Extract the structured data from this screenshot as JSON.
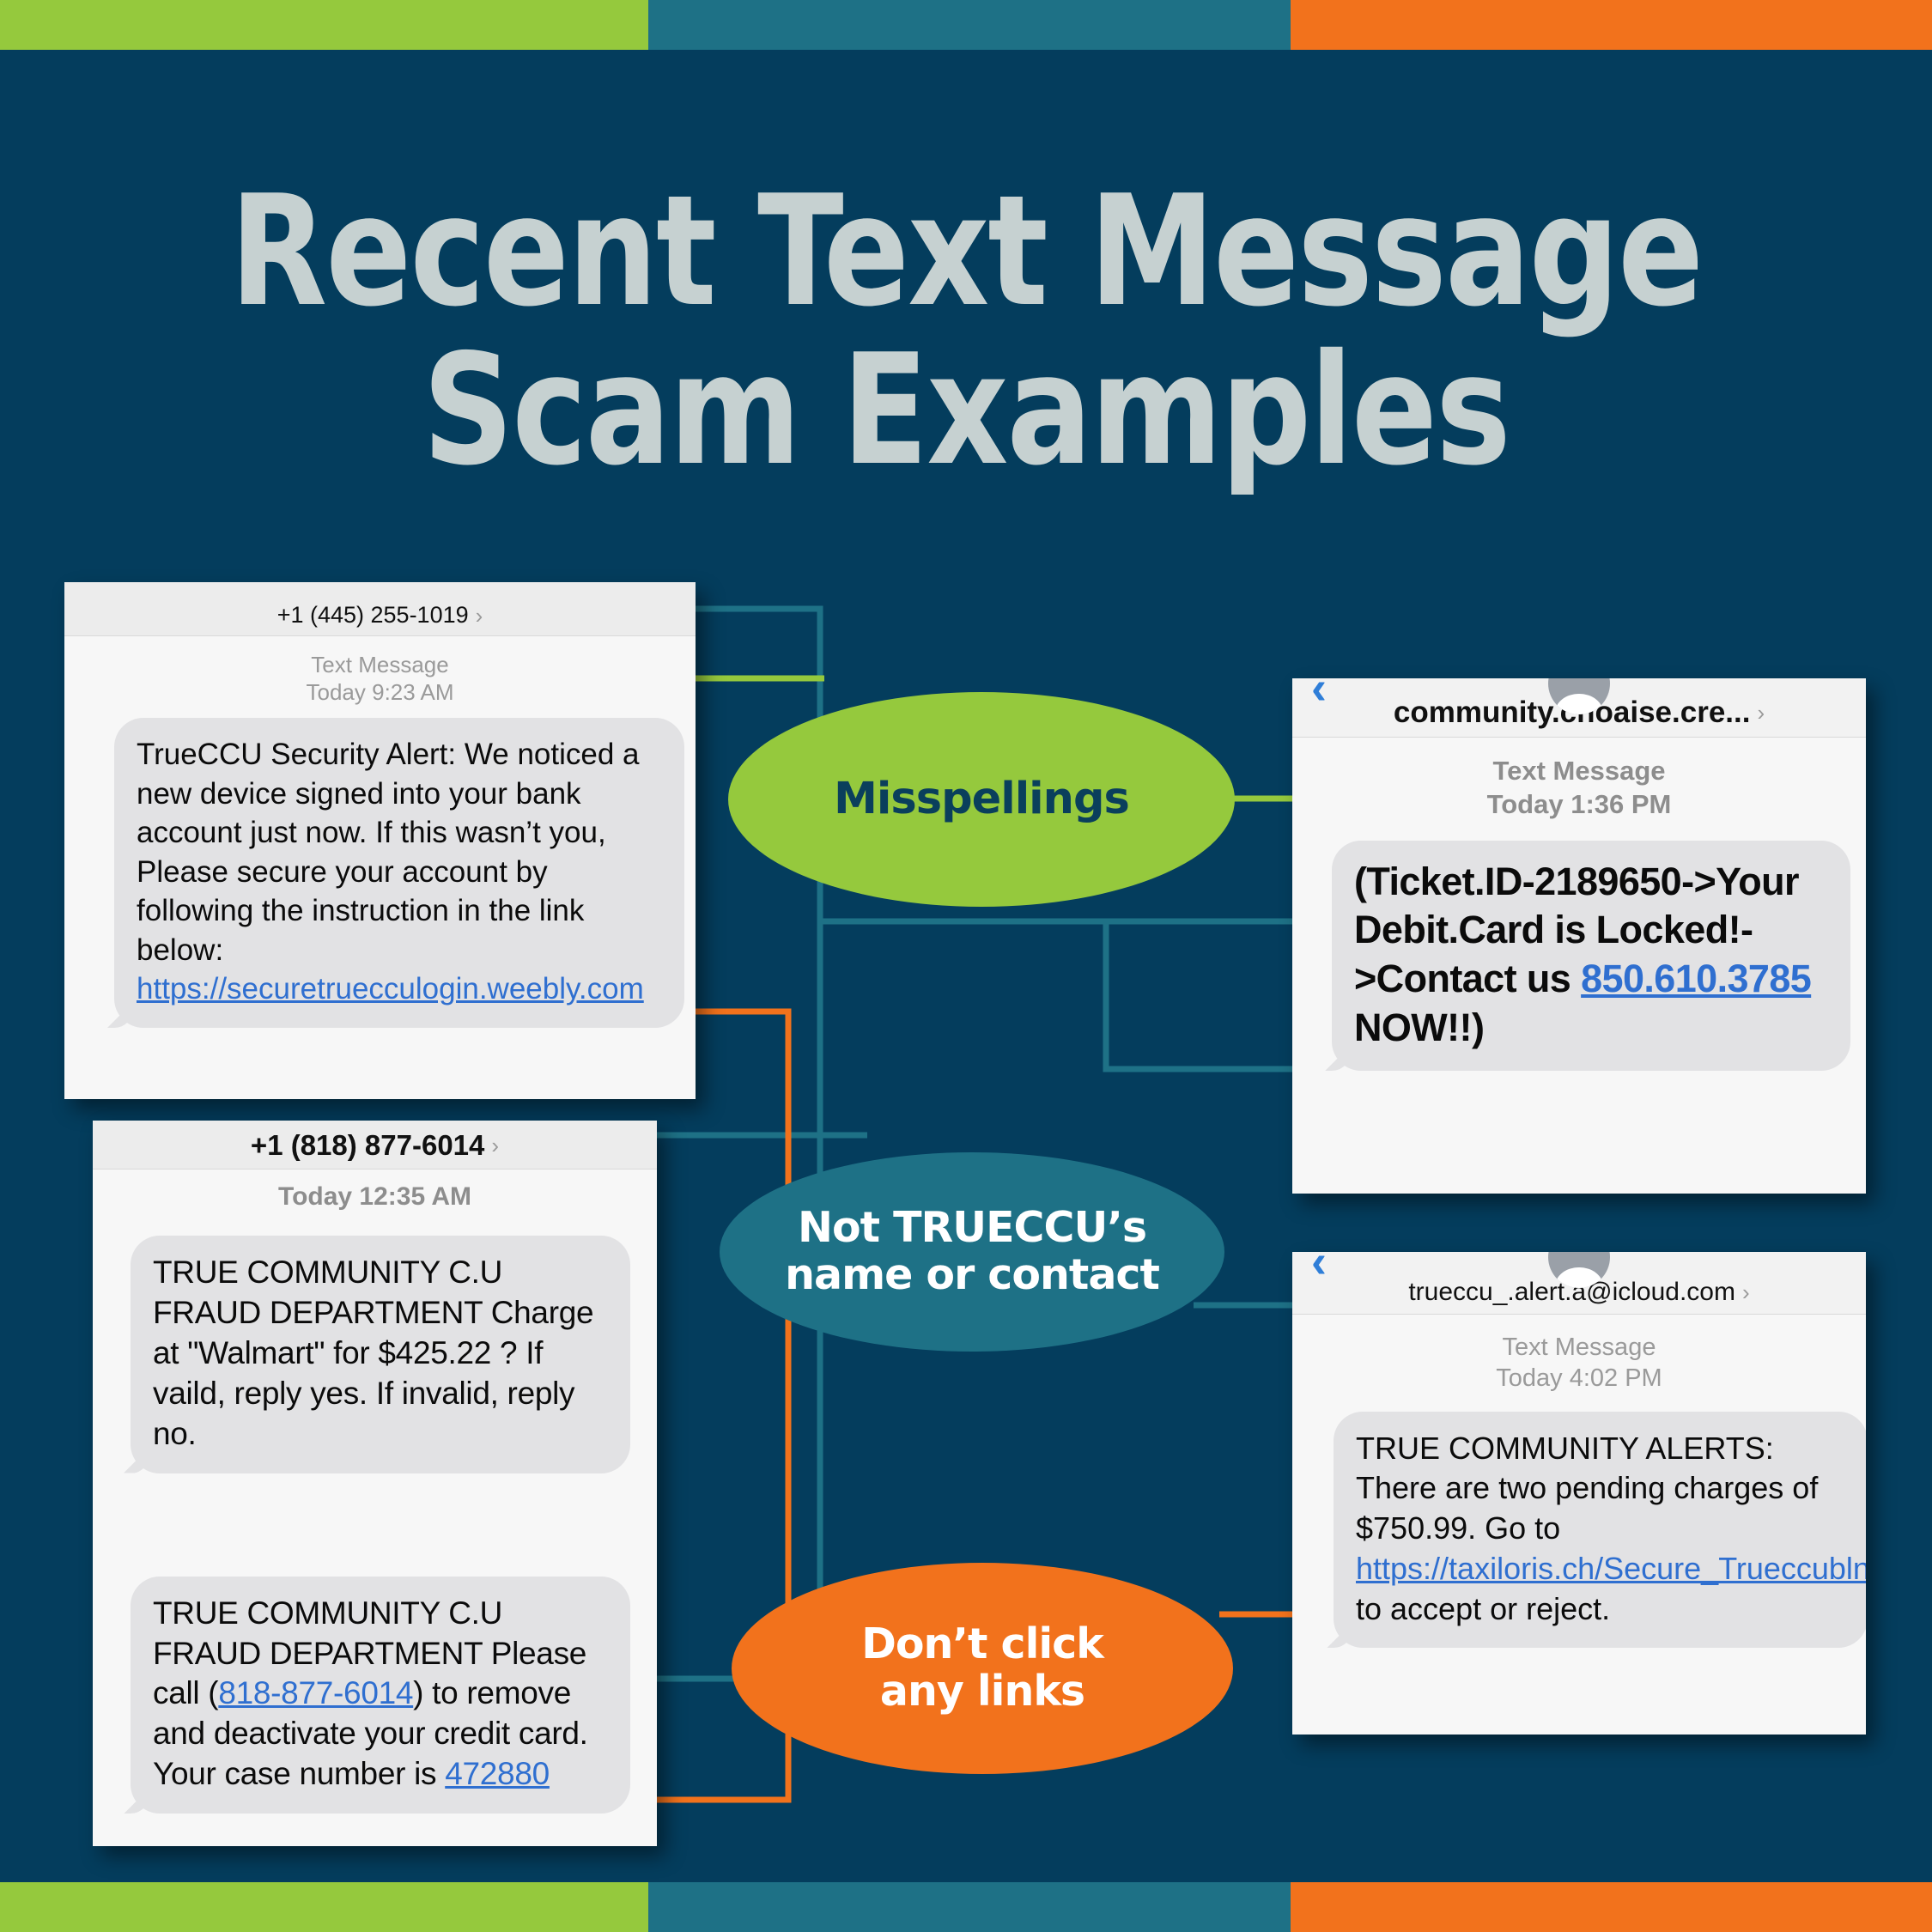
{
  "theme": {
    "background": "#043d5d",
    "green": "#95c93d",
    "teal": "#1e7186",
    "orange": "#f2721c",
    "title_color": "#c6d1d1",
    "link_blue": "#2f6fd0"
  },
  "header": {
    "title_line1": "Recent Text Message",
    "title_line2": "Scam Examples"
  },
  "bars": {
    "segments": [
      "green",
      "teal",
      "orange"
    ]
  },
  "callouts": [
    {
      "id": "misspellings",
      "label": "Misspellings",
      "color": "#95c93d",
      "text_color": "#0a3f5c"
    },
    {
      "id": "not-name-or-contact",
      "line1": "Not TRUECCU’s",
      "line2": "name or contact",
      "color": "#1e7186",
      "text_color": "#ffffff"
    },
    {
      "id": "dont-click-links",
      "line1": "Don’t click",
      "line2": "any links",
      "color": "#f2721c",
      "text_color": "#ffffff"
    }
  ],
  "cards": [
    {
      "id": "card-445-255-1019",
      "sender": "+1 (445) 255-1019",
      "chevron": "›",
      "meta_label": "Text Message",
      "meta_time": "Today 9:23 AM",
      "message_text": "TrueCCU Security Alert: We noticed a new device signed into your bank account just now. If this wasn’t you, Please secure your account by following the instruction in the link below: ",
      "message_link": "https://securetruecculogin.weebly.com"
    },
    {
      "id": "card-818-877-6014",
      "sender": "+1 (818) 877-6014",
      "chevron": "›",
      "meta_time": "Today 12:35 AM",
      "message_1": "TRUE COMMUNITY C.U FRAUD DEPARTMENT Charge at \"Walmart\" for $425.22 ? If vaild, reply yes. If invalid, reply no.",
      "message_2_pre": "TRUE COMMUNITY C.U FRAUD DEPARTMENT Please call (",
      "message_2_phone": "818-877-6014",
      "message_2_mid": ") to remove and deactivate your credit card. Your case number is ",
      "message_2_case": "472880"
    },
    {
      "id": "card-community-choaise",
      "sender": "community.choaise.cre...",
      "chevron": "›",
      "meta_label": "Text Message",
      "meta_time": "Today 1:36 PM",
      "message_pre": "(Ticket.ID-2189650->Your Debit.Card is Locked!->Contact us ",
      "message_phone": "850.610.3785",
      "message_post": " NOW!!)"
    },
    {
      "id": "card-trueccu-icloud",
      "sender": "trueccu_.alert.a@icloud.com",
      "chevron": "›",
      "meta_label": "Text Message",
      "meta_time": "Today 4:02 PM",
      "message_pre": "TRUE COMMUNITY ALERTS: There are two pending charges of $750.99. Go to ",
      "message_link": "https://taxiloris.ch/Secure_Trueccublngk/",
      "message_post": " to accept or reject."
    }
  ]
}
